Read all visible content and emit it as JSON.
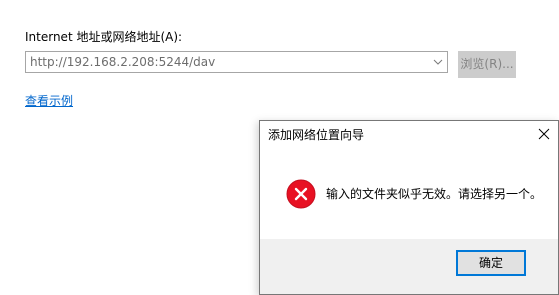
{
  "wizard": {
    "address_label": "Internet 地址或网络地址(A):",
    "address_value": "http://192.168.2.208:5244/dav",
    "browse_label": "浏览(R)...",
    "example_link": "查看示例"
  },
  "dialog": {
    "title": "添加网络位置向导",
    "message": "输入的文件夹似乎无效。请选择另一个。",
    "ok_label": "确定",
    "icon": "error-icon",
    "icon_color": "#e81123"
  },
  "colors": {
    "link": "#0066cc",
    "focus_border": "#0078d7",
    "footer_background": "#f0f0f0"
  }
}
